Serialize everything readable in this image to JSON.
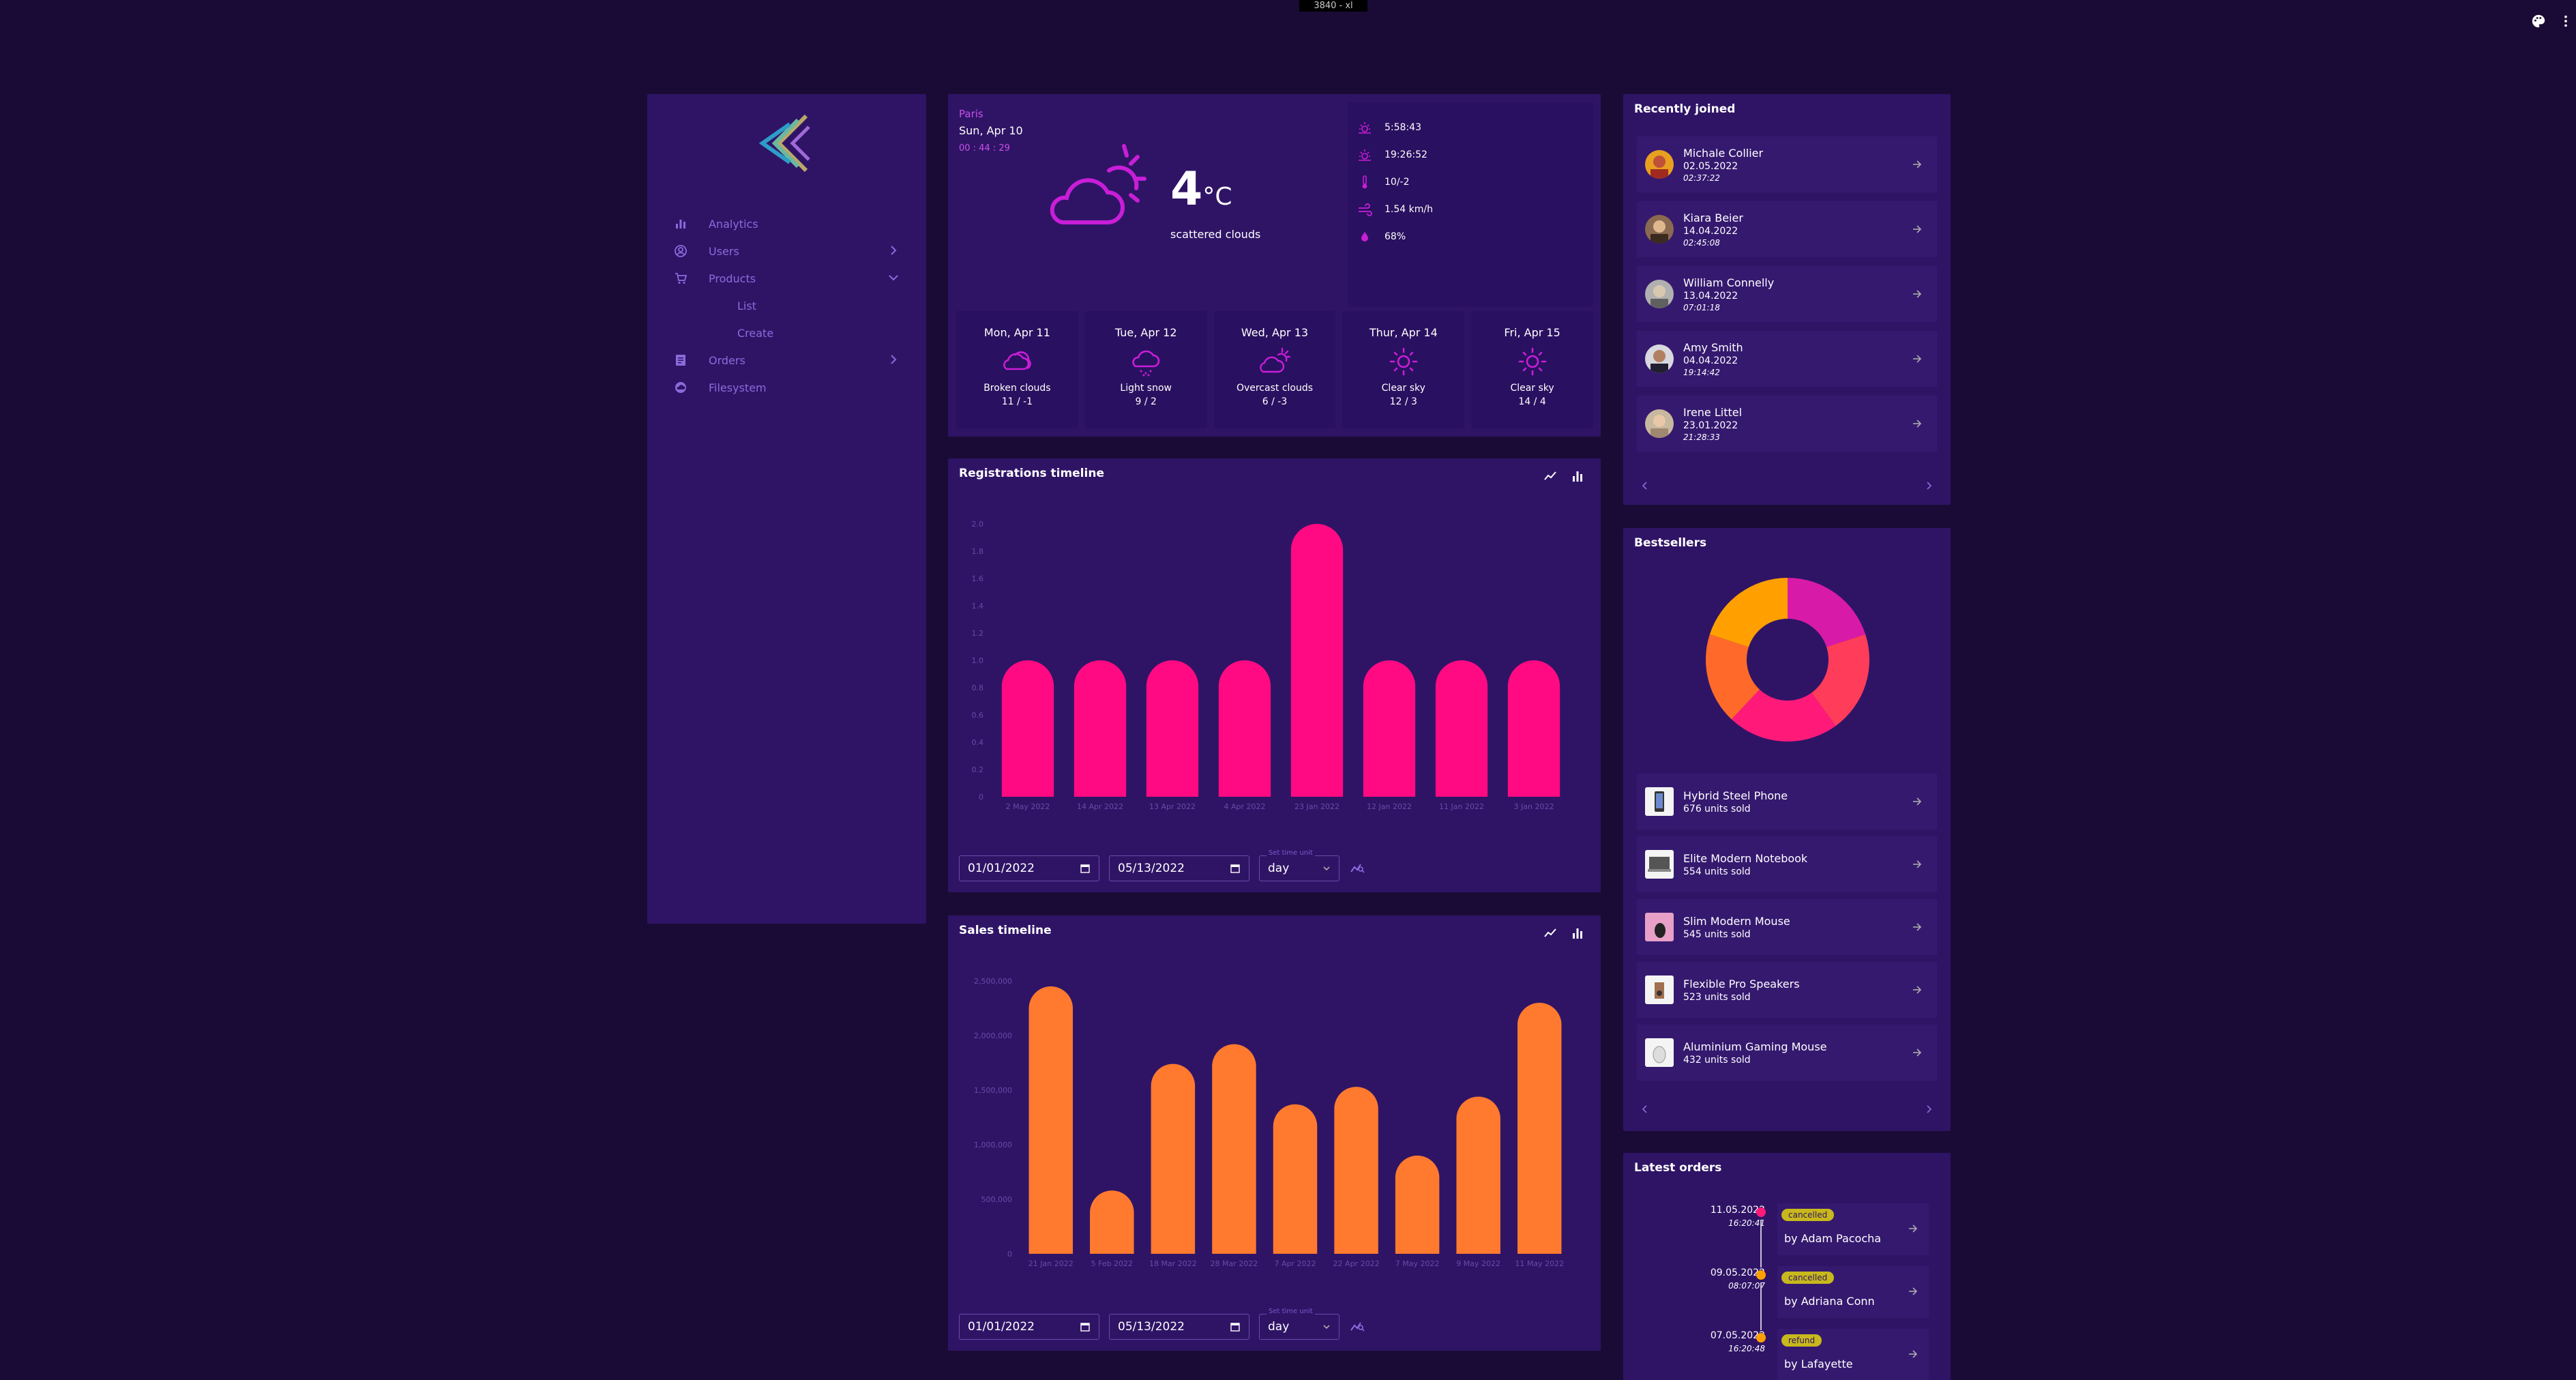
{
  "breakpoint_badge": "3840 - xl",
  "sidebar": {
    "items": [
      {
        "label": "Analytics",
        "icon": "bar-chart-icon"
      },
      {
        "label": "Users",
        "icon": "user-circle-icon"
      },
      {
        "label": "Products",
        "icon": "cart-icon"
      },
      {
        "label": "List"
      },
      {
        "label": "Create"
      },
      {
        "label": "Orders",
        "icon": "receipt-icon"
      },
      {
        "label": "Filesystem",
        "icon": "cloud-icon"
      }
    ]
  },
  "weather": {
    "city": "Paris",
    "date": "Sun, Apr 10",
    "time": "00 : 44 : 29",
    "temp": "4",
    "unit": "°C",
    "description": "scattered clouds",
    "stats": {
      "sunrise": "5:58:43",
      "sunset": "19:26:52",
      "minmax": "10/-2",
      "wind": "1.54 km/h",
      "humidity": "68%"
    },
    "forecast": [
      {
        "day": "Mon, Apr 11",
        "cond": "Broken clouds",
        "temp": "11 / -1",
        "icon": "clouds-icon"
      },
      {
        "day": "Tue, Apr 12",
        "cond": "Light snow",
        "temp": "9 / 2",
        "icon": "snow-icon"
      },
      {
        "day": "Wed, Apr 13",
        "cond": "Overcast clouds",
        "temp": "6 / -3",
        "icon": "partly-cloudy-icon"
      },
      {
        "day": "Thur, Apr 14",
        "cond": "Clear sky",
        "temp": "12 / 3",
        "icon": "sun-icon"
      },
      {
        "day": "Fri, Apr 15",
        "cond": "Clear sky",
        "temp": "14 / 4",
        "icon": "sun-icon"
      }
    ]
  },
  "registrations": {
    "title": "Registrations timeline",
    "from": "01/01/2022",
    "to": "05/13/2022",
    "unit_label": "Set time unit",
    "unit": "day"
  },
  "sales": {
    "title": "Sales timeline",
    "from": "01/01/2022",
    "to": "05/13/2022",
    "unit_label": "Set time unit",
    "unit": "day"
  },
  "chart_data": [
    {
      "type": "bar",
      "title": "Registrations timeline",
      "categories": [
        "2 May 2022",
        "14 Apr 2022",
        "13 Apr 2022",
        "4 Apr 2022",
        "23 Jan 2022",
        "12 Jan 2022",
        "11 Jan 2022",
        "3 Jan 2022"
      ],
      "values": [
        1,
        1,
        1,
        1,
        2,
        1,
        1,
        1
      ],
      "yticks": [
        "2.0",
        "1.8",
        "1.6",
        "1.4",
        "1.2",
        "1.0",
        "0.8",
        "0.6",
        "0.4",
        "0.2",
        "0"
      ],
      "ylim": [
        0,
        2
      ],
      "color": "#ff0a82"
    },
    {
      "type": "bar",
      "title": "Sales timeline",
      "categories": [
        "21 Jan 2022",
        "5 Feb 2022",
        "18 Mar 2022",
        "28 Mar 2022",
        "7 Apr 2022",
        "22 Apr 2022",
        "7 May 2022",
        "9 May 2022",
        "11 May 2022"
      ],
      "values": [
        2450000,
        580000,
        1740000,
        1920000,
        1370000,
        1530000,
        900000,
        1440000,
        2300000
      ],
      "yticks": [
        "2,500,000",
        "2,000,000",
        "1,500,000",
        "1,000,000",
        "500,000",
        "0"
      ],
      "ylim": [
        0,
        2500000
      ],
      "color": "#ff7a2e"
    }
  ],
  "recently_joined": {
    "title": "Recently joined",
    "users": [
      {
        "name": "Michale Collier",
        "date": "02.05.2022",
        "time": "02:37:22"
      },
      {
        "name": "Kiara Beier",
        "date": "14.04.2022",
        "time": "02:45:08"
      },
      {
        "name": "William Connelly",
        "date": "13.04.2022",
        "time": "07:01:18"
      },
      {
        "name": "Amy Smith",
        "date": "04.04.2022",
        "time": "19:14:42"
      },
      {
        "name": "Irene Littel",
        "date": "23.01.2022",
        "time": "21:28:33"
      }
    ]
  },
  "bestsellers": {
    "title": "Bestsellers",
    "products": [
      {
        "name": "Hybrid Steel Phone",
        "sold": "676 units sold"
      },
      {
        "name": "Elite Modern Notebook",
        "sold": "554 units sold"
      },
      {
        "name": "Slim Modern Mouse",
        "sold": "545 units sold"
      },
      {
        "name": "Flexible Pro Speakers",
        "sold": "523 units sold"
      },
      {
        "name": "Aluminium Gaming Mouse",
        "sold": "432 units sold"
      }
    ],
    "donut_colors": [
      "#d81aa8",
      "#ff3d5a",
      "#ff1a7a",
      "#ff6a2a",
      "#ffa000"
    ]
  },
  "latest_orders": {
    "title": "Latest orders",
    "orders": [
      {
        "date": "11.05.2022",
        "time": "16:20:41",
        "status": "cancelled",
        "by": "by Adam Pacocha",
        "dot": "#ff1a7a"
      },
      {
        "date": "09.05.2022",
        "time": "08:07:07",
        "status": "cancelled",
        "by": "by Adriana Conn",
        "dot": "#ffa000"
      },
      {
        "date": "07.05.2022",
        "time": "16:20:48",
        "status": "refund",
        "by": "by Lafayette",
        "dot": "#ffa000"
      }
    ]
  }
}
